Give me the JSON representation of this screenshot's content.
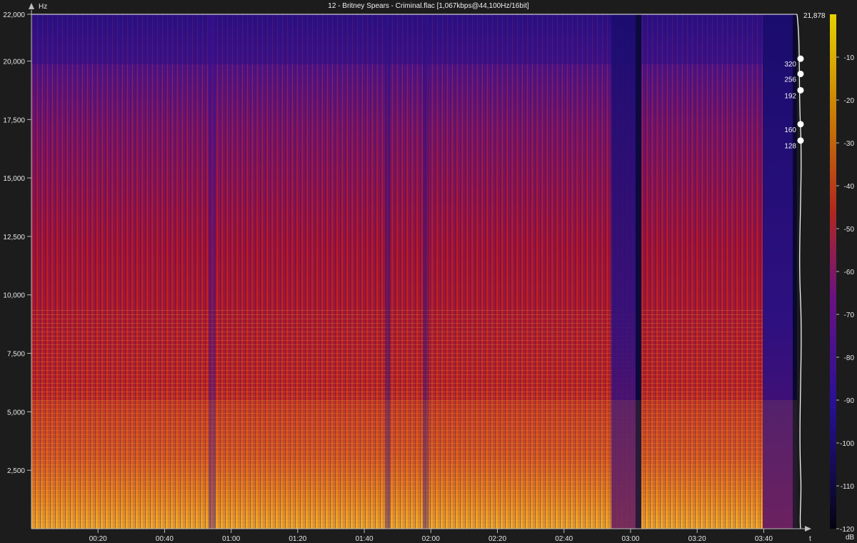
{
  "title": "12 - Britney Spears - Criminal.flac [1,067kbps@44,100Hz/16bit]",
  "chart_data": {
    "type": "heatmap",
    "title": "12 - Britney Spears - Criminal.flac [1,067kbps@44,100Hz/16bit]",
    "ylabel": "Hz",
    "xlabel": "t",
    "colorbar_label": "dB",
    "ylim": [
      0,
      22000
    ],
    "xlim_seconds": [
      0,
      230
    ],
    "y_ticks": [
      {
        "value": 2500,
        "label": "2,500"
      },
      {
        "value": 5000,
        "label": "5,000"
      },
      {
        "value": 7500,
        "label": "7,500"
      },
      {
        "value": 10000,
        "label": "10,000"
      },
      {
        "value": 12500,
        "label": "12,500"
      },
      {
        "value": 15000,
        "label": "15,000"
      },
      {
        "value": 17500,
        "label": "17,500"
      },
      {
        "value": 20000,
        "label": "20,000"
      },
      {
        "value": 22000,
        "label": "22,000"
      }
    ],
    "x_ticks": [
      {
        "value": 20,
        "label": "00:20"
      },
      {
        "value": 40,
        "label": "00:40"
      },
      {
        "value": 60,
        "label": "01:00"
      },
      {
        "value": 80,
        "label": "01:20"
      },
      {
        "value": 100,
        "label": "01:40"
      },
      {
        "value": 120,
        "label": "02:00"
      },
      {
        "value": 140,
        "label": "02:20"
      },
      {
        "value": 160,
        "label": "02:40"
      },
      {
        "value": 180,
        "label": "03:00"
      },
      {
        "value": 200,
        "label": "03:20"
      },
      {
        "value": 220,
        "label": "03:40"
      }
    ],
    "colorbar_ticks": [
      {
        "value": -10,
        "label": "-10"
      },
      {
        "value": -20,
        "label": "-20"
      },
      {
        "value": -30,
        "label": "-30"
      },
      {
        "value": -40,
        "label": "-40"
      },
      {
        "value": -50,
        "label": "-50"
      },
      {
        "value": -60,
        "label": "-60"
      },
      {
        "value": -70,
        "label": "-70"
      },
      {
        "value": -80,
        "label": "-80"
      },
      {
        "value": -90,
        "label": "-90"
      },
      {
        "value": -100,
        "label": "-100"
      },
      {
        "value": -110,
        "label": "-110"
      },
      {
        "value": -120,
        "label": "-120"
      }
    ],
    "colorbar_range": [
      -120,
      0
    ],
    "max_frequency_label": "21,878",
    "max_frequency_hz": 21878,
    "bitrate_markers": [
      {
        "label": "320",
        "hz": 20100
      },
      {
        "label": "256",
        "hz": 19450
      },
      {
        "label": "192",
        "hz": 18750
      },
      {
        "label": "160",
        "hz": 17300
      },
      {
        "label": "128",
        "hz": 16600
      }
    ],
    "colormap": [
      "#06061e",
      "#1c0f7a",
      "#5a1490",
      "#b01440",
      "#d8341c",
      "#f08a0c",
      "#f6d23c"
    ]
  }
}
